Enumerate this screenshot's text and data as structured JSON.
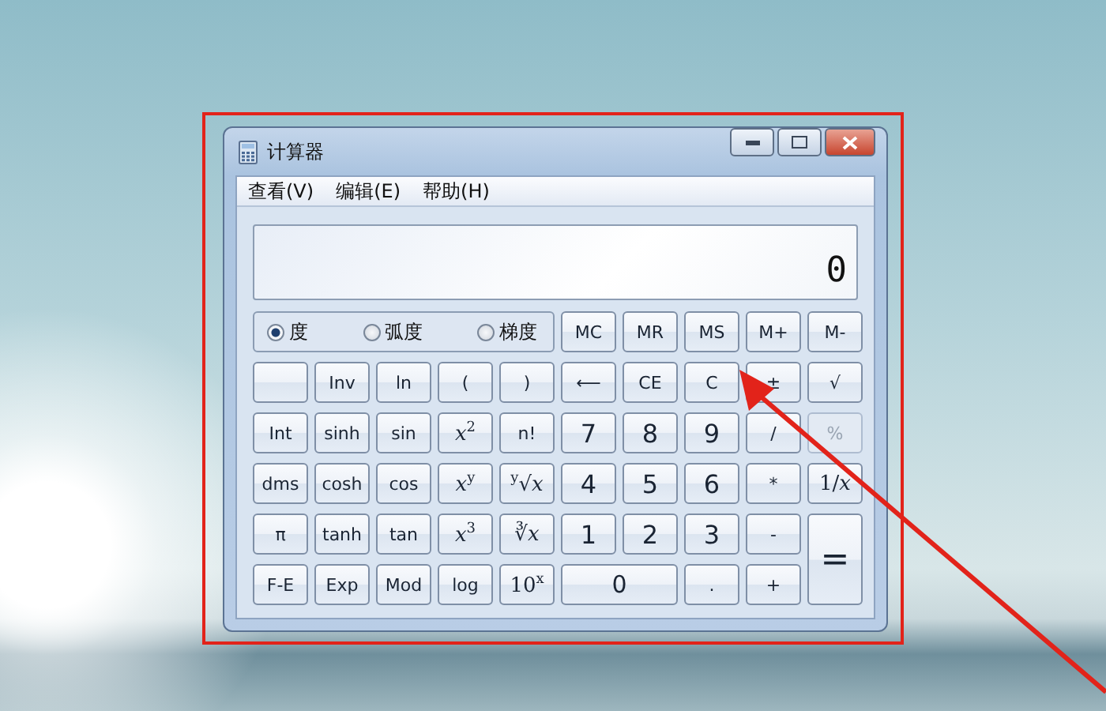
{
  "window": {
    "title": "计算器"
  },
  "menu": [
    "查看(V)",
    "编辑(E)",
    "帮助(H)"
  ],
  "display": {
    "value": "0"
  },
  "angle_units": [
    {
      "label": "度",
      "selected": true
    },
    {
      "label": "弧度",
      "selected": false
    },
    {
      "label": "梯度",
      "selected": false
    }
  ],
  "buttons": [
    {
      "label": "MC",
      "kind": "normal",
      "disabled": false
    },
    {
      "label": "MR",
      "kind": "normal",
      "disabled": false
    },
    {
      "label": "MS",
      "kind": "normal",
      "disabled": false
    },
    {
      "label": "M+",
      "kind": "normal",
      "disabled": false
    },
    {
      "label": "M-",
      "kind": "normal",
      "disabled": false
    },
    {
      "kind": "blank",
      "disabled": false
    },
    {
      "label": "Inv",
      "kind": "normal",
      "disabled": false
    },
    {
      "label": "ln",
      "kind": "normal",
      "disabled": false
    },
    {
      "label": "(",
      "kind": "normal",
      "disabled": false
    },
    {
      "label": ")",
      "kind": "normal",
      "disabled": false
    },
    {
      "label": "⟵",
      "kind": "normal",
      "disabled": false
    },
    {
      "label": "CE",
      "kind": "normal",
      "disabled": false
    },
    {
      "label": "C",
      "kind": "normal",
      "disabled": false
    },
    {
      "label": "±",
      "kind": "normal",
      "disabled": false
    },
    {
      "label": "√",
      "kind": "normal",
      "disabled": false
    },
    {
      "label": "Int",
      "kind": "normal",
      "disabled": false
    },
    {
      "label": "sinh",
      "kind": "normal",
      "disabled": false
    },
    {
      "label": "sin",
      "kind": "normal",
      "disabled": false
    },
    {
      "label": "*x*$^{2}$",
      "kind": "math",
      "disabled": false
    },
    {
      "label": "n!",
      "kind": "normal",
      "disabled": false
    },
    {
      "label": "7",
      "kind": "digit",
      "disabled": false
    },
    {
      "label": "8",
      "kind": "digit",
      "disabled": false
    },
    {
      "label": "9",
      "kind": "digit",
      "disabled": false
    },
    {
      "label": "/",
      "kind": "normal",
      "disabled": false
    },
    {
      "label": "%",
      "kind": "normal",
      "disabled": true
    },
    {
      "label": "dms",
      "kind": "normal",
      "disabled": false
    },
    {
      "label": "cosh",
      "kind": "normal",
      "disabled": false
    },
    {
      "label": "cos",
      "kind": "normal",
      "disabled": false
    },
    {
      "label": "*x*$^{y}$",
      "kind": "math",
      "disabled": false
    },
    {
      "label": "$^{y}$√*x*",
      "kind": "math",
      "disabled": false
    },
    {
      "label": "4",
      "kind": "digit",
      "disabled": false
    },
    {
      "label": "5",
      "kind": "digit",
      "disabled": false
    },
    {
      "label": "6",
      "kind": "digit",
      "disabled": false
    },
    {
      "label": "*",
      "kind": "normal",
      "disabled": false
    },
    {
      "label": "1/*x*",
      "kind": "math",
      "disabled": false
    },
    {
      "label": "π",
      "kind": "normal",
      "disabled": false
    },
    {
      "label": "tanh",
      "kind": "normal",
      "disabled": false
    },
    {
      "label": "tan",
      "kind": "normal",
      "disabled": false
    },
    {
      "label": "*x*$^{3}$",
      "kind": "math",
      "disabled": false
    },
    {
      "label": "∛*x*",
      "kind": "math",
      "disabled": false
    },
    {
      "label": "1",
      "kind": "digit",
      "disabled": false
    },
    {
      "label": "2",
      "kind": "digit",
      "disabled": false
    },
    {
      "label": "3",
      "kind": "digit",
      "disabled": false
    },
    {
      "label": "-",
      "kind": "normal",
      "disabled": false
    },
    {
      "label": "=",
      "kind": "tall",
      "disabled": false
    },
    {
      "label": "F-E",
      "kind": "normal",
      "disabled": false
    },
    {
      "label": "Exp",
      "kind": "normal",
      "disabled": false
    },
    {
      "label": "Mod",
      "kind": "normal",
      "disabled": false
    },
    {
      "label": "log",
      "kind": "normal",
      "disabled": false
    },
    {
      "label": "10$^{x}$",
      "kind": "math",
      "disabled": false
    },
    {
      "label": "0",
      "kind": "wide",
      "disabled": false
    },
    {
      "label": ".",
      "kind": "normal",
      "disabled": false
    },
    {
      "label": "+",
      "kind": "normal",
      "disabled": false
    }
  ]
}
